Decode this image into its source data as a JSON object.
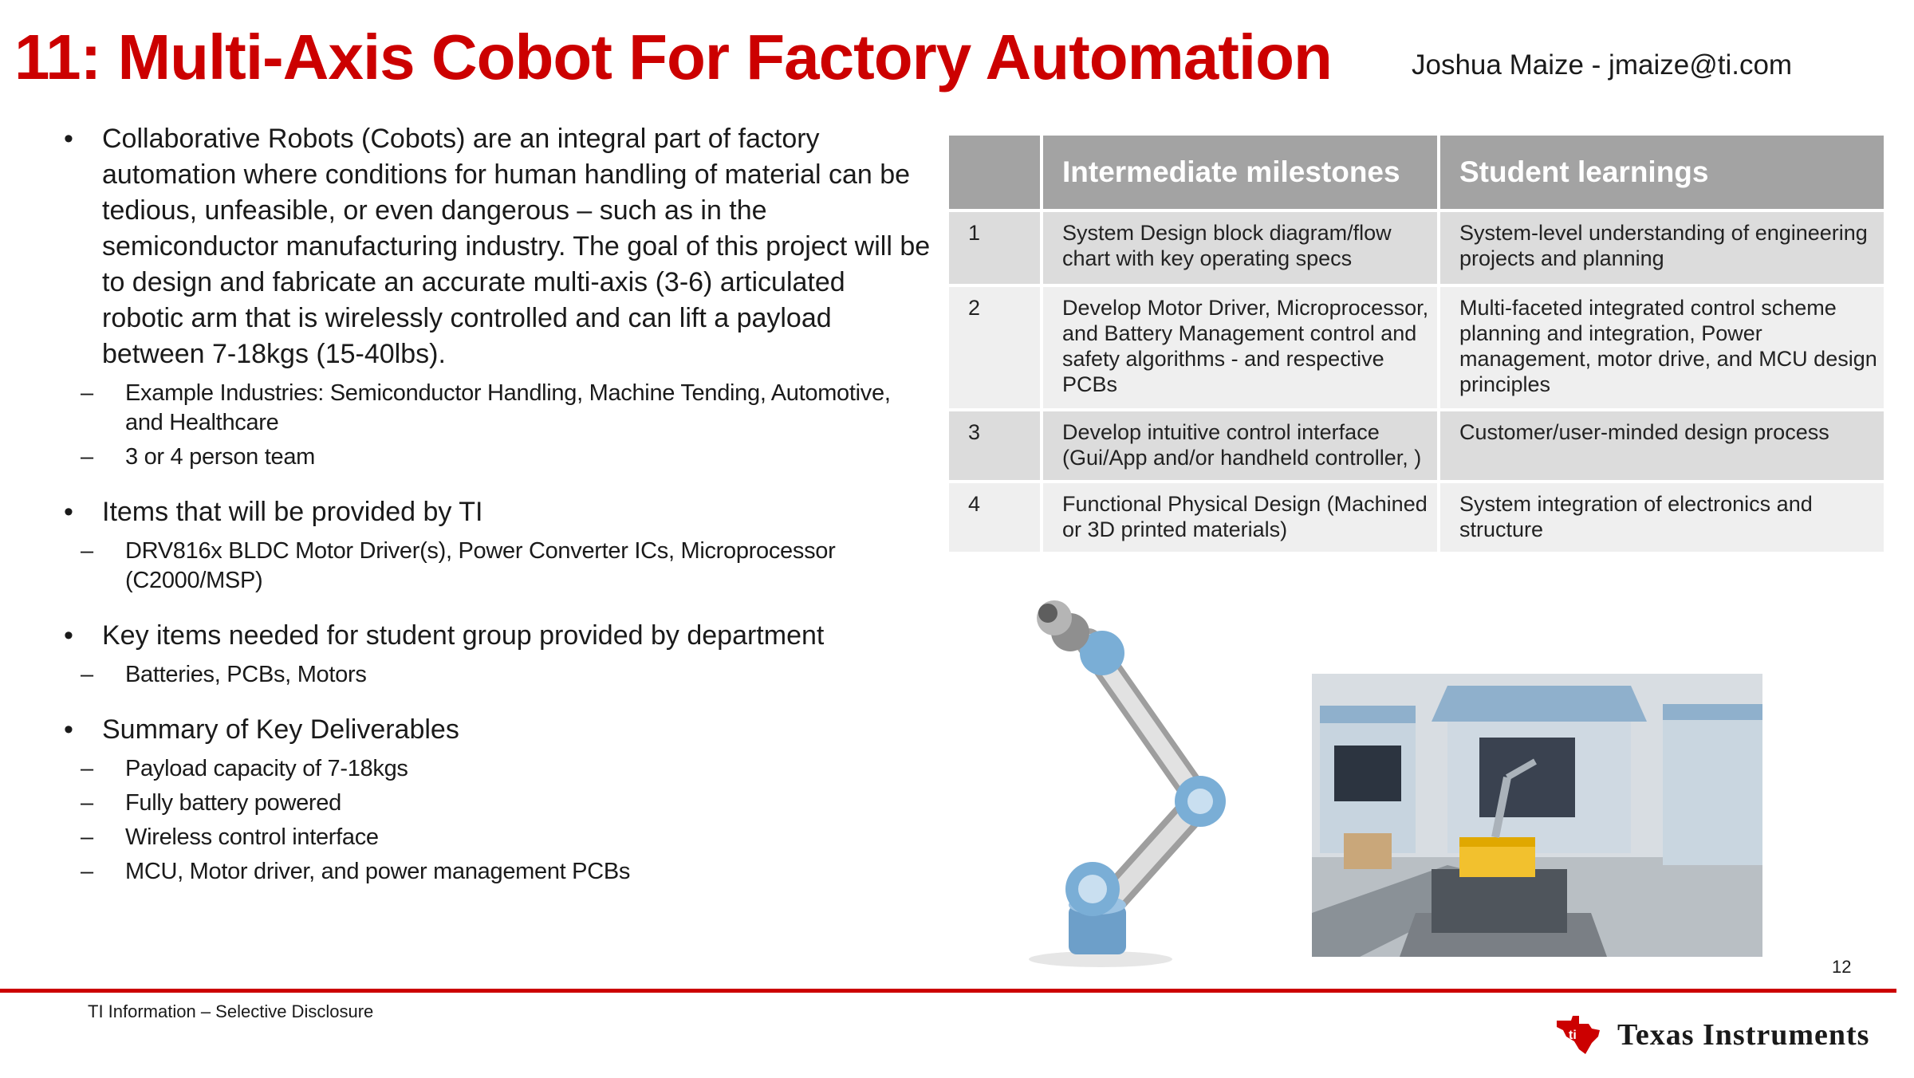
{
  "header": {
    "title": "11: Multi-Axis  Cobot For Factory Automation",
    "author": "Joshua Maize - jmaize@ti.com"
  },
  "bullets": [
    {
      "text": "Collaborative Robots (Cobots) are an integral part of factory automation where conditions for human handling of material can be tedious, unfeasible, or even dangerous – such as in the semiconductor manufacturing industry. The goal of this project will be to design and fabricate an accurate multi-axis (3-6) articulated robotic arm that is wirelessly controlled and can lift a payload between 7-18kgs (15-40lbs).",
      "subs": [
        "Example Industries: Semiconductor Handling, Machine Tending, Automotive, and Healthcare",
        "3 or 4 person team"
      ]
    },
    {
      "text": "Items that will be provided by TI",
      "subs": [
        "DRV816x BLDC Motor Driver(s), Power Converter ICs, Microprocessor (C2000/MSP)"
      ]
    },
    {
      "text": "Key items needed for student group provided by department",
      "subs": [
        "Batteries, PCBs, Motors"
      ]
    },
    {
      "text": "Summary of Key Deliverables",
      "subs": [
        "Payload capacity of 7-18kgs",
        "Fully battery powered",
        "Wireless control interface",
        "MCU, Motor driver, and power management PCBs"
      ]
    }
  ],
  "table": {
    "headers": [
      "",
      "Intermediate milestones",
      "Student learnings"
    ],
    "rows": [
      [
        "1",
        "System Design block diagram/flow chart with key operating specs",
        "System-level understanding of engineering projects and planning"
      ],
      [
        "2",
        "Develop Motor Driver, Microprocessor, and Battery Management control and safety algorithms - and respective PCBs",
        "Multi-faceted integrated control scheme planning and integration, Power management, motor drive, and MCU design principles"
      ],
      [
        "3",
        "Develop intuitive control interface (Gui/App and/or handheld controller, )",
        "Customer/user-minded design process"
      ],
      [
        "4",
        "Functional Physical Design (Machined or 3D printed materials)",
        "System integration of electronics and structure"
      ]
    ]
  },
  "footer": {
    "page_number": "12",
    "note": "TI Information – Selective Disclosure",
    "logo_text": "Texas Instruments"
  },
  "colors": {
    "accent_red": "#cc0000",
    "table_header": "#a3a3a3",
    "row_dark": "#dcdcdc",
    "row_light": "#efefef",
    "robot_joint_blue": "#7aaed6"
  }
}
